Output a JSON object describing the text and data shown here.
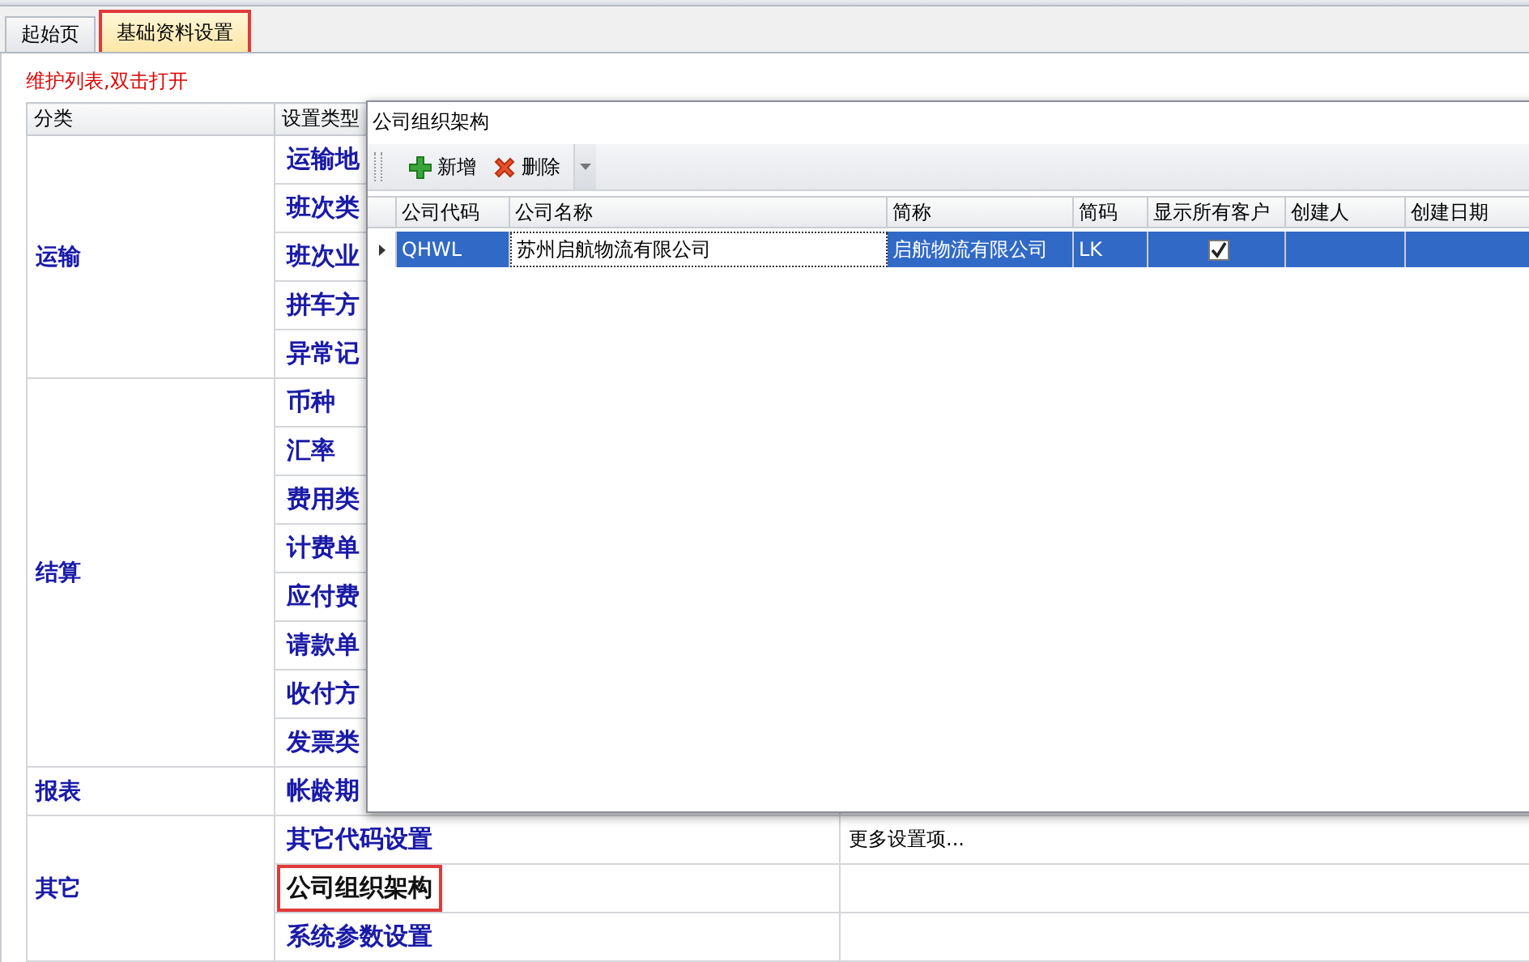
{
  "tabs": [
    {
      "label": "起始页",
      "selected": false,
      "highlighted": false
    },
    {
      "label": "基础资料设置",
      "selected": true,
      "highlighted": true
    }
  ],
  "hint": "维护列表,双击打开",
  "table": {
    "columns": [
      "分类",
      "设置类型"
    ],
    "groups": [
      {
        "category": "运输",
        "items": [
          {
            "label": "运输地",
            "selected": false,
            "highlighted": false
          },
          {
            "label": "班次类",
            "selected": false,
            "highlighted": false
          },
          {
            "label": "班次业",
            "selected": false,
            "highlighted": false
          },
          {
            "label": "拼车方",
            "selected": false,
            "highlighted": false
          },
          {
            "label": "异常记",
            "selected": false,
            "highlighted": false
          }
        ]
      },
      {
        "category": "结算",
        "items": [
          {
            "label": "币种",
            "selected": false,
            "highlighted": false
          },
          {
            "label": "汇率",
            "selected": false,
            "highlighted": false
          },
          {
            "label": "费用类",
            "selected": false,
            "highlighted": false
          },
          {
            "label": "计费单",
            "selected": false,
            "highlighted": false
          },
          {
            "label": "应付费",
            "selected": false,
            "highlighted": false
          },
          {
            "label": "请款单",
            "selected": false,
            "highlighted": false
          },
          {
            "label": "收付方",
            "selected": false,
            "highlighted": false
          },
          {
            "label": "发票类",
            "selected": false,
            "highlighted": false
          }
        ]
      },
      {
        "category": "报表",
        "items": [
          {
            "label": "帐龄期",
            "selected": false,
            "highlighted": false
          }
        ]
      },
      {
        "category": "其它",
        "items": [
          {
            "label": "其它代码设置",
            "selected": false,
            "highlighted": false,
            "note": "更多设置项..."
          },
          {
            "label": "公司组织架构",
            "selected": true,
            "highlighted": true
          },
          {
            "label": "系统参数设置",
            "selected": false,
            "highlighted": false
          }
        ]
      }
    ]
  },
  "dialog": {
    "title": "公司组织架构",
    "toolbar": [
      {
        "kind": "add",
        "label": "新增"
      },
      {
        "kind": "delete",
        "label": "删除"
      }
    ],
    "columns": [
      {
        "label": "公司代码",
        "kind": "text"
      },
      {
        "label": "公司名称",
        "kind": "text"
      },
      {
        "label": "简称",
        "kind": "text"
      },
      {
        "label": "简码",
        "kind": "text"
      },
      {
        "label": "显示所有客户",
        "kind": "check"
      },
      {
        "label": "创建人",
        "kind": "text"
      },
      {
        "label": "创建日期",
        "kind": "text"
      }
    ],
    "rows": [
      {
        "selected": true,
        "cells": [
          {
            "text": "QHWL",
            "focused": false
          },
          {
            "text": "苏州启航物流有限公司",
            "focused": true
          },
          {
            "text": "启航物流有限公司",
            "focused": false
          },
          {
            "text": "LK",
            "focused": false
          },
          {
            "focused": false
          },
          {
            "focused": false
          },
          {
            "focused": false
          }
        ],
        "checked": true
      }
    ]
  }
}
